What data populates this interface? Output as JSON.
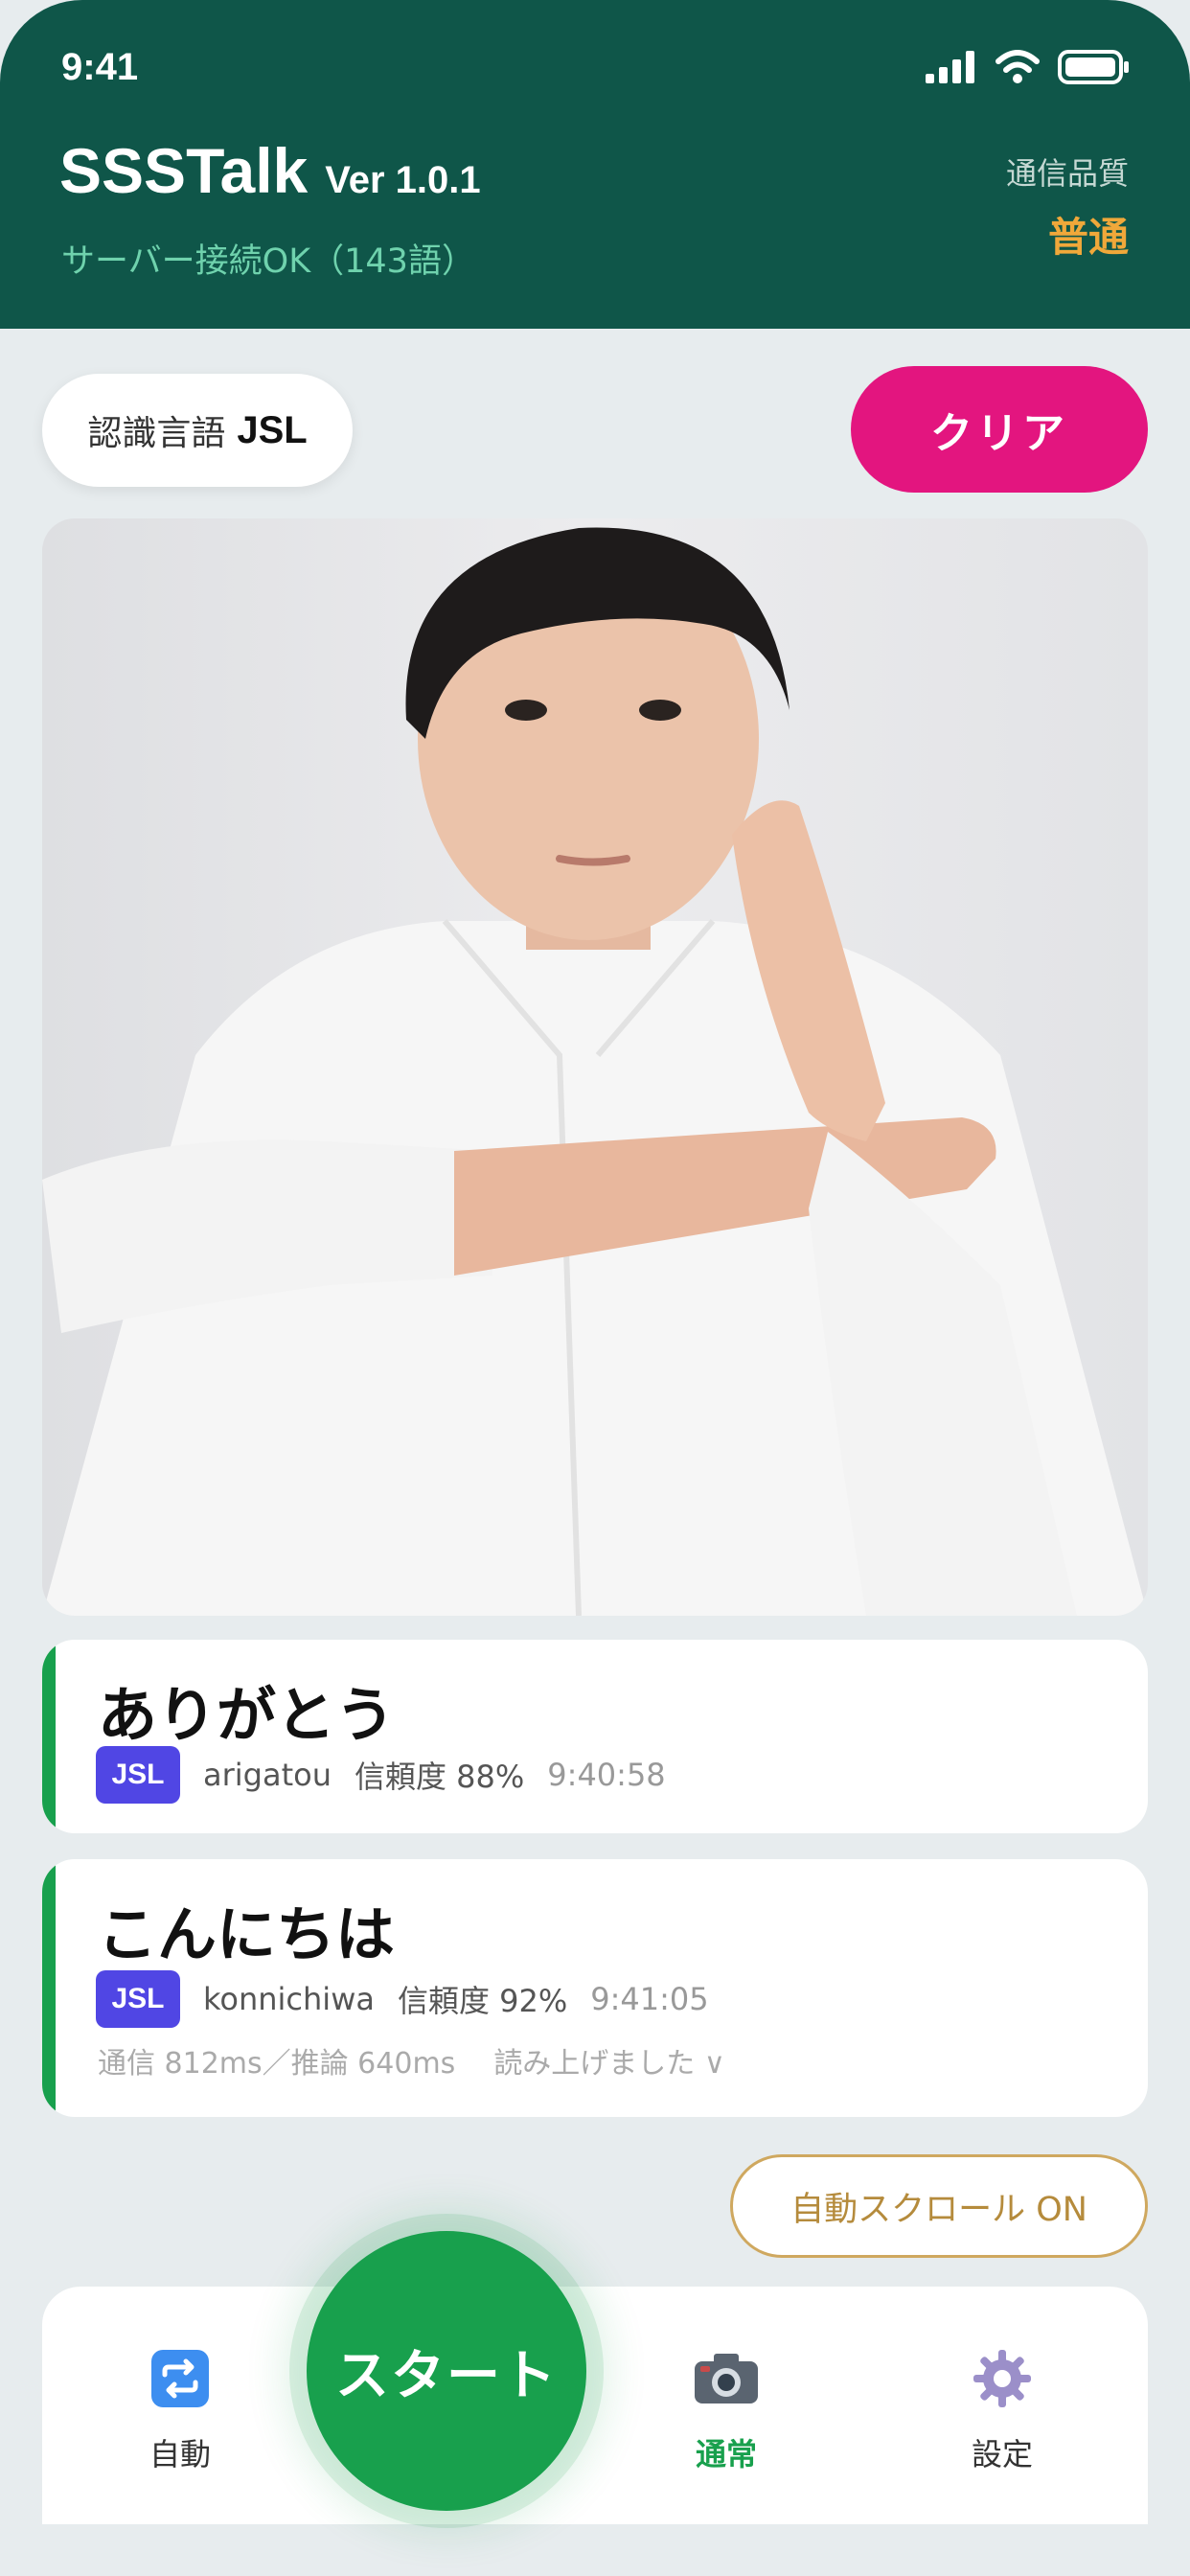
{
  "status_bar": {
    "time": "9:41"
  },
  "header": {
    "app_name": "SSSTalk",
    "version": "Ver 1.0.1",
    "server_status": "サーバー接続OK（143語）",
    "quality_label": "通信品質",
    "quality_value": "普通"
  },
  "controls": {
    "lang_label": "認識言語",
    "lang_value": "JSL",
    "clear_label": "クリア"
  },
  "results": [
    {
      "word": "ありがとう",
      "lang": "JSL",
      "romaji": "arigatou",
      "confidence": "信頼度 88%",
      "time": "9:40:58"
    },
    {
      "word": "こんにちは",
      "lang": "JSL",
      "romaji": "konnichiwa",
      "confidence": "信頼度 92%",
      "time": "9:41:05",
      "latency": "通信 812ms／推論 640ms",
      "spoken": "読み上げました ∨"
    }
  ],
  "autoscroll_label": "自動スクロール ON",
  "nav": {
    "start_label": "スタート",
    "items": [
      {
        "label": "自動",
        "icon": "repeat-icon"
      },
      {
        "label": "通常",
        "icon": "camera-icon",
        "active": true
      },
      {
        "label": "設定",
        "icon": "gear-icon"
      }
    ]
  },
  "colors": {
    "header_bg": "#0f5649",
    "accent_green": "#18a04d",
    "clear_pink": "#e3157f",
    "quality_orange": "#f0a83a",
    "jsl_badge": "#5046e4",
    "autoscroll_gold": "#cfa85f"
  }
}
